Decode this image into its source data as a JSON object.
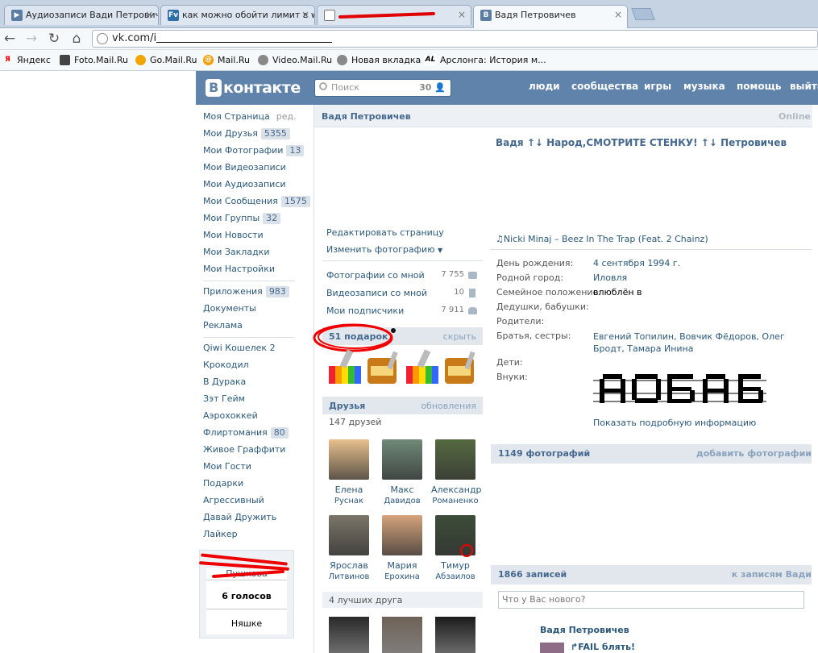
{
  "browser": {
    "tabs": [
      {
        "title": "Аудиозаписи Вади Петрович",
        "icon": "vk-play-icon",
        "color": "#5b7da4"
      },
      {
        "title": "как можно обойти лимит в w",
        "icon": "fv-icon",
        "color": "#2f6fa8"
      },
      {
        "title": "",
        "icon": "globe-icon",
        "color": "#777777"
      },
      {
        "title": "Вадя Петровичев",
        "icon": "vk-icon",
        "color": "#5b7da4"
      }
    ],
    "close_glyph": "×",
    "url_prefix": "vk.com/i",
    "bookmarks": [
      "Яндекс",
      "Foto.Mail.Ru",
      "Go.Mail.Ru",
      "Mail.Ru",
      "Video.Mail.Ru",
      "Новая вкладка",
      "Арслонга: История м..."
    ]
  },
  "header": {
    "logo_letter": "В",
    "logo": "контакте",
    "search_placeholder": "Поиск",
    "search_count": "30",
    "nav": [
      "люди",
      "сообщества",
      "игры",
      "музыка",
      "помощь",
      "выйти"
    ]
  },
  "sidebar": {
    "items": [
      {
        "label": "Моя Страница",
        "extra": "ред."
      },
      {
        "label": "Мои Друзья",
        "count": "5355"
      },
      {
        "label": "Мои Фотографии",
        "count": "13"
      },
      {
        "label": "Мои Видеозаписи"
      },
      {
        "label": "Мои Аудиозаписи"
      },
      {
        "label": "Мои Сообщения",
        "count": "1575"
      },
      {
        "label": "Мои Группы",
        "count": "32"
      },
      {
        "label": "Мои Новости"
      },
      {
        "label": "Мои Закладки"
      },
      {
        "label": "Мои Настройки"
      }
    ],
    "items2": [
      {
        "label": "Приложения",
        "count": "983"
      },
      {
        "label": "Документы"
      },
      {
        "label": "Реклама"
      }
    ],
    "apps": [
      {
        "label": "Qiwi Кошелек 2"
      },
      {
        "label": "Крокодил"
      },
      {
        "label": "В Дурака"
      },
      {
        "label": "Зэт Гейм"
      },
      {
        "label": "Аэрохоккей"
      },
      {
        "label": "Флиртомания",
        "count": "80"
      },
      {
        "label": "Живое Граффити"
      },
      {
        "label": "Мои Гости"
      },
      {
        "label": "Подарки"
      },
      {
        "label": "Агрессивный"
      },
      {
        "label": "Давай Дружить"
      },
      {
        "label": "Лайкер"
      }
    ],
    "poll": {
      "option": "Пушкова",
      "votes": "6 голосов",
      "other": "Няшке"
    }
  },
  "profile": {
    "name": "Вадя Петровичев",
    "online": "Online",
    "status": "Вадя ↑↓ Народ,СМОТРИТЕ СТЕНКУ! ↑↓ Петровичев",
    "edit_page": "Редактировать страницу",
    "change_photo": "Изменить фотографию",
    "lists": [
      {
        "label": "Фотографии со мной",
        "count": "7 755"
      },
      {
        "label": "Видеозаписи со мной",
        "count": "10"
      },
      {
        "label": "Мои подписчики",
        "count": "7 911"
      }
    ],
    "gifts": {
      "title": "51 подарок",
      "hide": "скрыть"
    },
    "friends": {
      "title": "Друзья",
      "updates": "обновления",
      "count": "147 друзей",
      "list": [
        {
          "first": "Елена",
          "last": "Руснак",
          "color": "#e7c08e"
        },
        {
          "first": "Макс",
          "last": "Давидов",
          "color": "#6f8a78"
        },
        {
          "first": "Александр",
          "last": "Романенко",
          "color": "#556a40"
        },
        {
          "first": "Ярослав",
          "last": "Литвинов",
          "color": "#7b7568"
        },
        {
          "first": "Мария",
          "last": "Ерохина",
          "color": "#d5a37c"
        },
        {
          "first": "Тимур",
          "last": "Абзаилов",
          "color": "#3c4c38"
        }
      ],
      "best_title": "4 лучших друга",
      "best_colors": [
        "#2a2a2a",
        "#6e6258",
        "#1c1c1c"
      ]
    },
    "song": "Nicki Minaj – Beez In The Trap (Feat. 2 Chainz)",
    "info": [
      {
        "label": "День рождения:",
        "value": "4 сентября 1994 г.",
        "link": true
      },
      {
        "label": "Родной город:",
        "value": "Иловля",
        "link": true
      },
      {
        "label": "Семейное положение:",
        "value": "влюблён в",
        "link": false
      },
      {
        "label": "Дедушки, бабушки:",
        "value": "",
        "link": false
      },
      {
        "label": "Родители:",
        "value": "",
        "link": false
      },
      {
        "label": "Братья, сестры:",
        "value": "Евгений Топилин, Вовчик Фёдоров, Олег Бродт, Тамара Инина",
        "link": true
      },
      {
        "label": "Дети:",
        "value": "",
        "link": false
      },
      {
        "label": "Внуки:",
        "value": "",
        "link": false
      }
    ],
    "show_more": "Показать подробную информацию",
    "photos": {
      "title": "1149 фотографий",
      "add": "добавить фотографии"
    },
    "wall": {
      "title": "1866 записей",
      "link": "к записям Вади",
      "placeholder": "Что у Вас нового?"
    },
    "post": {
      "author": "Вадя Петровичев",
      "text": "FAIL блять!"
    }
  }
}
